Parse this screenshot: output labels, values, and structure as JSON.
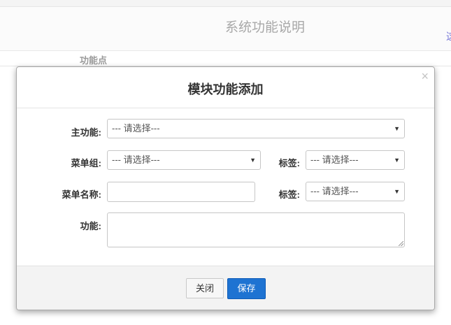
{
  "background": {
    "page_title": "系统功能说明",
    "edge_link": "这",
    "column_header": "功能点"
  },
  "modal": {
    "title": "模块功能添加",
    "close_symbol": "×",
    "fields": {
      "main_function": {
        "label": "主功能:",
        "selected": "--- 请选择---"
      },
      "menu_group": {
        "label": "菜单组:",
        "selected": "--- 请选择---"
      },
      "tag1": {
        "label": "标签:",
        "selected": "--- 请选择---"
      },
      "menu_name": {
        "label": "菜单名称:",
        "value": ""
      },
      "tag2": {
        "label": "标签:",
        "selected": "--- 请选择---"
      },
      "function": {
        "label": "功能:",
        "value": ""
      }
    },
    "footer": {
      "close_label": "关闭",
      "save_label": "保存"
    }
  },
  "colors": {
    "primary_button": "#1e73d2",
    "border": "#c6c6c6",
    "footer_bg": "#f3f3f3"
  },
  "icons": {
    "dropdown": "caret-down-icon",
    "close": "close-icon",
    "resize": "resize-grip-icon"
  }
}
